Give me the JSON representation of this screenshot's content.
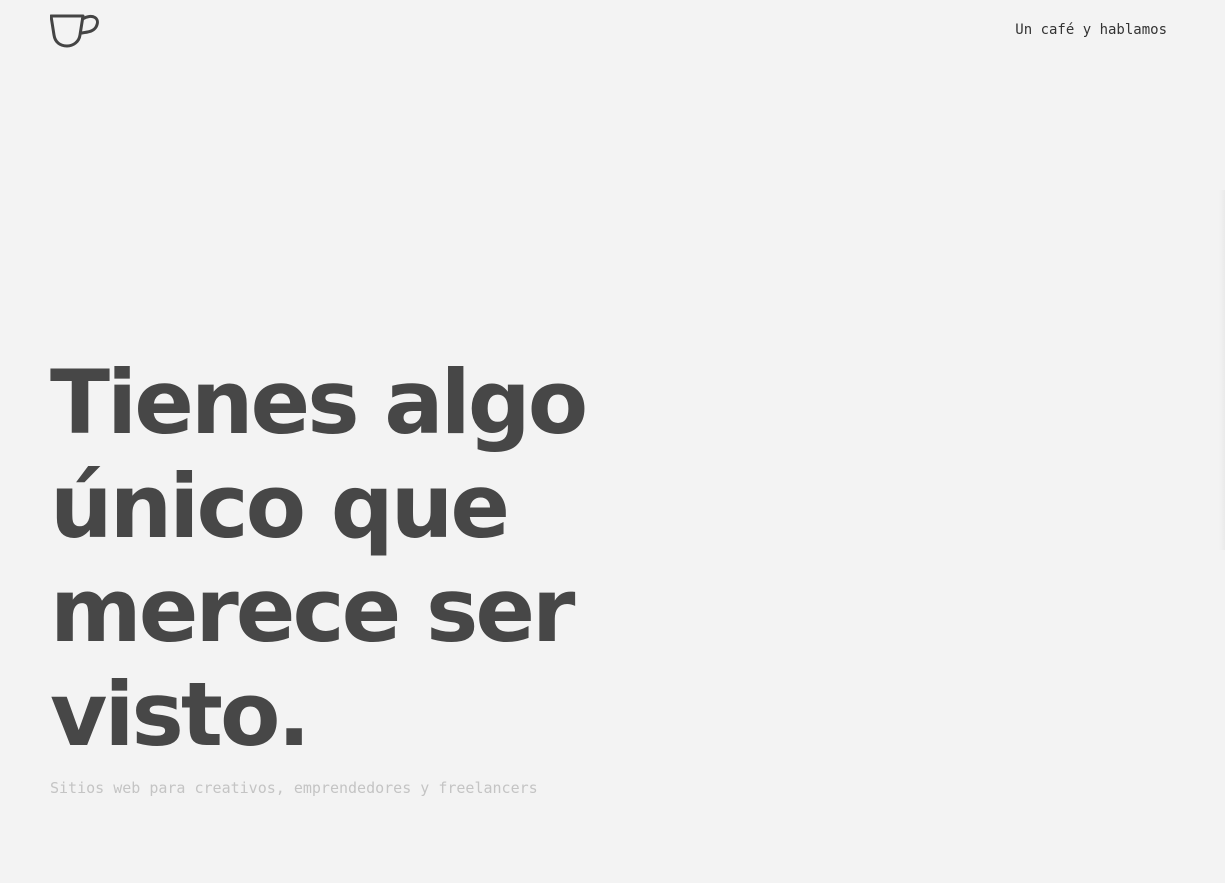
{
  "header": {
    "logo_icon": "coffee-cup-icon",
    "nav_link_label": "Un café y hablamos"
  },
  "hero": {
    "title_lines": [
      "Tienes algo",
      "único que",
      "merece ser",
      "visto."
    ],
    "subtitle": "Sitios web para creativos, emprendedores y freelancers"
  },
  "colors": {
    "background": "#f3f3f3",
    "title": "#474747",
    "subtitle": "#c4c4c4",
    "nav_text": "#333333",
    "logo_stroke": "#444444"
  }
}
